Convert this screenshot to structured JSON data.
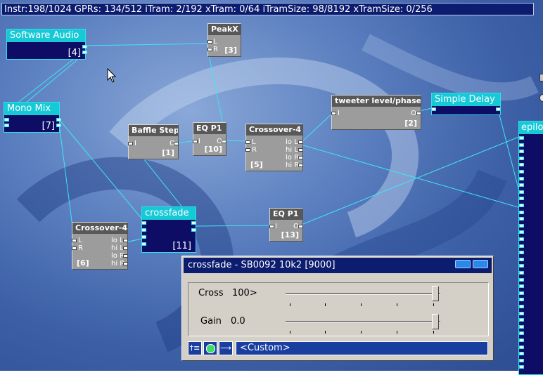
{
  "status": {
    "text": "Instr:198/1024 GPRs: 134/512 iTram: 2/192 xTram: 0/64 iTramSize: 98/8192 xTramSize: 0/256"
  },
  "blocks": {
    "software_audio": {
      "title": "Software Audio",
      "index": "[4]"
    },
    "mono_mix": {
      "title": "Mono Mix",
      "index": "[7]"
    },
    "crossfade": {
      "title": "crossfade",
      "index": "[11]"
    },
    "simple_delay": {
      "title": "Simple Delay"
    },
    "epilog": {
      "title": "epilog"
    },
    "peakx": {
      "title": "PeakX",
      "index": "[3]",
      "ports": [
        "L",
        "R"
      ]
    },
    "baffle_step": {
      "title": "Baffle Step",
      "index": "[1]",
      "ports": [
        "I",
        "O"
      ]
    },
    "eq_p1_top": {
      "title": "EQ P1",
      "index": "[10]",
      "ports": [
        "I",
        "O"
      ]
    },
    "crossover_top": {
      "title": "Crossover-4",
      "index": "[5]",
      "inputs": [
        "L",
        "R"
      ],
      "outputs": [
        "lo L",
        "hi L",
        "lo R",
        "hi R"
      ]
    },
    "tweeter": {
      "title": "tweeter level/phase",
      "index": "[2]",
      "ports": [
        "I",
        "O"
      ]
    },
    "eq_p1_bottom": {
      "title": "EQ P1",
      "index": "[13]",
      "ports": [
        "I",
        "O"
      ]
    },
    "crossover_bottom": {
      "title": "Crossover-4",
      "index": "[6]",
      "inputs": [
        "L",
        "R"
      ],
      "outputs": [
        "lo L",
        "hi L",
        "lo R",
        "hi R"
      ]
    }
  },
  "dialog": {
    "title": "crossfade - SB0092 10k2 [9000]",
    "cross_label": "Cross",
    "cross_value": "100>",
    "cross_level": 1.0,
    "gain_label": "Gain",
    "gain_value": "0.0",
    "gain_level": 1.0,
    "preset": "<Custom>"
  },
  "colors": {
    "desktop": "#4a6cb0",
    "cyan_block_title": "#15c9d6",
    "cyan_block_body": "#0d0d66",
    "wire": "#3ee6f4",
    "grey_block": "#9c9c9c",
    "dialog_face": "#d4d0c8",
    "status_bar": "#0c1c6e"
  },
  "icons": [
    "mouse-cursor-icon",
    "tree-view-icon",
    "green-dot-icon",
    "arrow-right-icon",
    "minimize-button-icon",
    "close-button-icon"
  ]
}
